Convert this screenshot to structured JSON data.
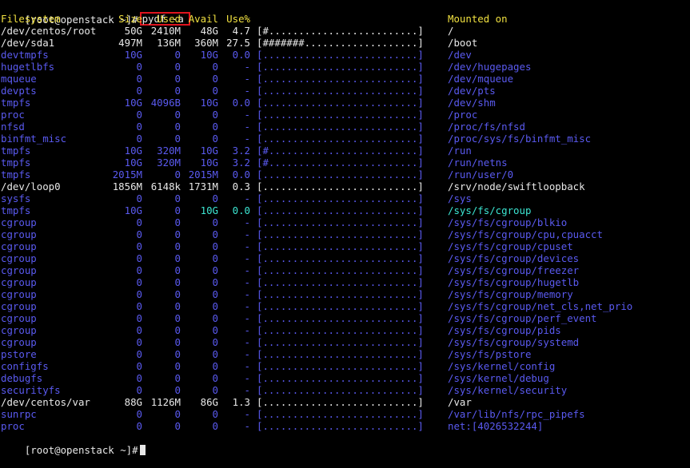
{
  "colors": {
    "background": "#000000",
    "default_text": "#e8e8e8",
    "header": "#f0e040",
    "pseudo_fs": "#5a5af0",
    "highlight": "#3ce6d2",
    "command_box": "#e0141e"
  },
  "prompt": {
    "text": "[root@openstack ~]#",
    "command": "pydf -a"
  },
  "header": {
    "filesystem": "Filesystem",
    "size": "Size",
    "used": "Used",
    "avail": "Avail",
    "use_pct": "Use%",
    "mounted_on": "Mounted on"
  },
  "rows": [
    {
      "fs": "/dev/centos/root",
      "size": "50G",
      "used": "2410M",
      "avail": "48G",
      "use": "4.7",
      "bar": "[#.........................]",
      "mount": "/",
      "style": "normal"
    },
    {
      "fs": "/dev/sda1",
      "size": "497M",
      "used": "136M",
      "avail": "360M",
      "use": "27.5",
      "bar": "[#######...................]",
      "mount": "/boot",
      "style": "normal"
    },
    {
      "fs": "devtmpfs",
      "size": "10G",
      "used": "0",
      "avail": "10G",
      "use": "0.0",
      "bar": "[..........................]",
      "mount": "/dev",
      "style": "pseudo"
    },
    {
      "fs": "hugetlbfs",
      "size": "0",
      "used": "0",
      "avail": "0",
      "use": "-",
      "bar": "[..........................]",
      "mount": "/dev/hugepages",
      "style": "pseudo"
    },
    {
      "fs": "mqueue",
      "size": "0",
      "used": "0",
      "avail": "0",
      "use": "-",
      "bar": "[..........................]",
      "mount": "/dev/mqueue",
      "style": "pseudo"
    },
    {
      "fs": "devpts",
      "size": "0",
      "used": "0",
      "avail": "0",
      "use": "-",
      "bar": "[..........................]",
      "mount": "/dev/pts",
      "style": "pseudo"
    },
    {
      "fs": "tmpfs",
      "size": "10G",
      "used": "4096B",
      "avail": "10G",
      "use": "0.0",
      "bar": "[..........................]",
      "mount": "/dev/shm",
      "style": "pseudo"
    },
    {
      "fs": "proc",
      "size": "0",
      "used": "0",
      "avail": "0",
      "use": "-",
      "bar": "[..........................]",
      "mount": "/proc",
      "style": "pseudo"
    },
    {
      "fs": "nfsd",
      "size": "0",
      "used": "0",
      "avail": "0",
      "use": "-",
      "bar": "[..........................]",
      "mount": "/proc/fs/nfsd",
      "style": "pseudo"
    },
    {
      "fs": "binfmt_misc",
      "size": "0",
      "used": "0",
      "avail": "0",
      "use": "-",
      "bar": "[..........................]",
      "mount": "/proc/sys/fs/binfmt_misc",
      "style": "pseudo"
    },
    {
      "fs": "tmpfs",
      "size": "10G",
      "used": "320M",
      "avail": "10G",
      "use": "3.2",
      "bar": "[#.........................]",
      "mount": "/run",
      "style": "pseudo"
    },
    {
      "fs": "tmpfs",
      "size": "10G",
      "used": "320M",
      "avail": "10G",
      "use": "3.2",
      "bar": "[#.........................]",
      "mount": "/run/netns",
      "style": "pseudo"
    },
    {
      "fs": "tmpfs",
      "size": "2015M",
      "used": "0",
      "avail": "2015M",
      "use": "0.0",
      "bar": "[..........................]",
      "mount": "/run/user/0",
      "style": "pseudo"
    },
    {
      "fs": "/dev/loop0",
      "size": "1856M",
      "used": "6148k",
      "avail": "1731M",
      "use": "0.3",
      "bar": "[..........................]",
      "mount": "/srv/node/swiftloopback",
      "style": "normal"
    },
    {
      "fs": "sysfs",
      "size": "0",
      "used": "0",
      "avail": "0",
      "use": "-",
      "bar": "[..........................]",
      "mount": "/sys",
      "style": "pseudo"
    },
    {
      "fs": "tmpfs",
      "size": "10G",
      "used": "0",
      "avail": "10G",
      "use": "0.0",
      "bar": "[..........................]",
      "mount": "/sys/fs/cgroup",
      "style": "highlight"
    },
    {
      "fs": "cgroup",
      "size": "0",
      "used": "0",
      "avail": "0",
      "use": "-",
      "bar": "[..........................]",
      "mount": "/sys/fs/cgroup/blkio",
      "style": "pseudo"
    },
    {
      "fs": "cgroup",
      "size": "0",
      "used": "0",
      "avail": "0",
      "use": "-",
      "bar": "[..........................]",
      "mount": "/sys/fs/cgroup/cpu,cpuacct",
      "style": "pseudo"
    },
    {
      "fs": "cgroup",
      "size": "0",
      "used": "0",
      "avail": "0",
      "use": "-",
      "bar": "[..........................]",
      "mount": "/sys/fs/cgroup/cpuset",
      "style": "pseudo"
    },
    {
      "fs": "cgroup",
      "size": "0",
      "used": "0",
      "avail": "0",
      "use": "-",
      "bar": "[..........................]",
      "mount": "/sys/fs/cgroup/devices",
      "style": "pseudo"
    },
    {
      "fs": "cgroup",
      "size": "0",
      "used": "0",
      "avail": "0",
      "use": "-",
      "bar": "[..........................]",
      "mount": "/sys/fs/cgroup/freezer",
      "style": "pseudo"
    },
    {
      "fs": "cgroup",
      "size": "0",
      "used": "0",
      "avail": "0",
      "use": "-",
      "bar": "[..........................]",
      "mount": "/sys/fs/cgroup/hugetlb",
      "style": "pseudo"
    },
    {
      "fs": "cgroup",
      "size": "0",
      "used": "0",
      "avail": "0",
      "use": "-",
      "bar": "[..........................]",
      "mount": "/sys/fs/cgroup/memory",
      "style": "pseudo"
    },
    {
      "fs": "cgroup",
      "size": "0",
      "used": "0",
      "avail": "0",
      "use": "-",
      "bar": "[..........................]",
      "mount": "/sys/fs/cgroup/net_cls,net_prio",
      "style": "pseudo"
    },
    {
      "fs": "cgroup",
      "size": "0",
      "used": "0",
      "avail": "0",
      "use": "-",
      "bar": "[..........................]",
      "mount": "/sys/fs/cgroup/perf_event",
      "style": "pseudo"
    },
    {
      "fs": "cgroup",
      "size": "0",
      "used": "0",
      "avail": "0",
      "use": "-",
      "bar": "[..........................]",
      "mount": "/sys/fs/cgroup/pids",
      "style": "pseudo"
    },
    {
      "fs": "cgroup",
      "size": "0",
      "used": "0",
      "avail": "0",
      "use": "-",
      "bar": "[..........................]",
      "mount": "/sys/fs/cgroup/systemd",
      "style": "pseudo"
    },
    {
      "fs": "pstore",
      "size": "0",
      "used": "0",
      "avail": "0",
      "use": "-",
      "bar": "[..........................]",
      "mount": "/sys/fs/pstore",
      "style": "pseudo"
    },
    {
      "fs": "configfs",
      "size": "0",
      "used": "0",
      "avail": "0",
      "use": "-",
      "bar": "[..........................]",
      "mount": "/sys/kernel/config",
      "style": "pseudo"
    },
    {
      "fs": "debugfs",
      "size": "0",
      "used": "0",
      "avail": "0",
      "use": "-",
      "bar": "[..........................]",
      "mount": "/sys/kernel/debug",
      "style": "pseudo"
    },
    {
      "fs": "securityfs",
      "size": "0",
      "used": "0",
      "avail": "0",
      "use": "-",
      "bar": "[..........................]",
      "mount": "/sys/kernel/security",
      "style": "pseudo"
    },
    {
      "fs": "/dev/centos/var",
      "size": "88G",
      "used": "1126M",
      "avail": "86G",
      "use": "1.3",
      "bar": "[..........................]",
      "mount": "/var",
      "style": "normal"
    },
    {
      "fs": "sunrpc",
      "size": "0",
      "used": "0",
      "avail": "0",
      "use": "-",
      "bar": "[..........................]",
      "mount": "/var/lib/nfs/rpc_pipefs",
      "style": "pseudo"
    },
    {
      "fs": "proc",
      "size": "0",
      "used": "0",
      "avail": "0",
      "use": "-",
      "bar": "[..........................]",
      "mount": "net:[4026532244]",
      "style": "pseudo"
    }
  ],
  "final_prompt": "[root@openstack ~]#"
}
